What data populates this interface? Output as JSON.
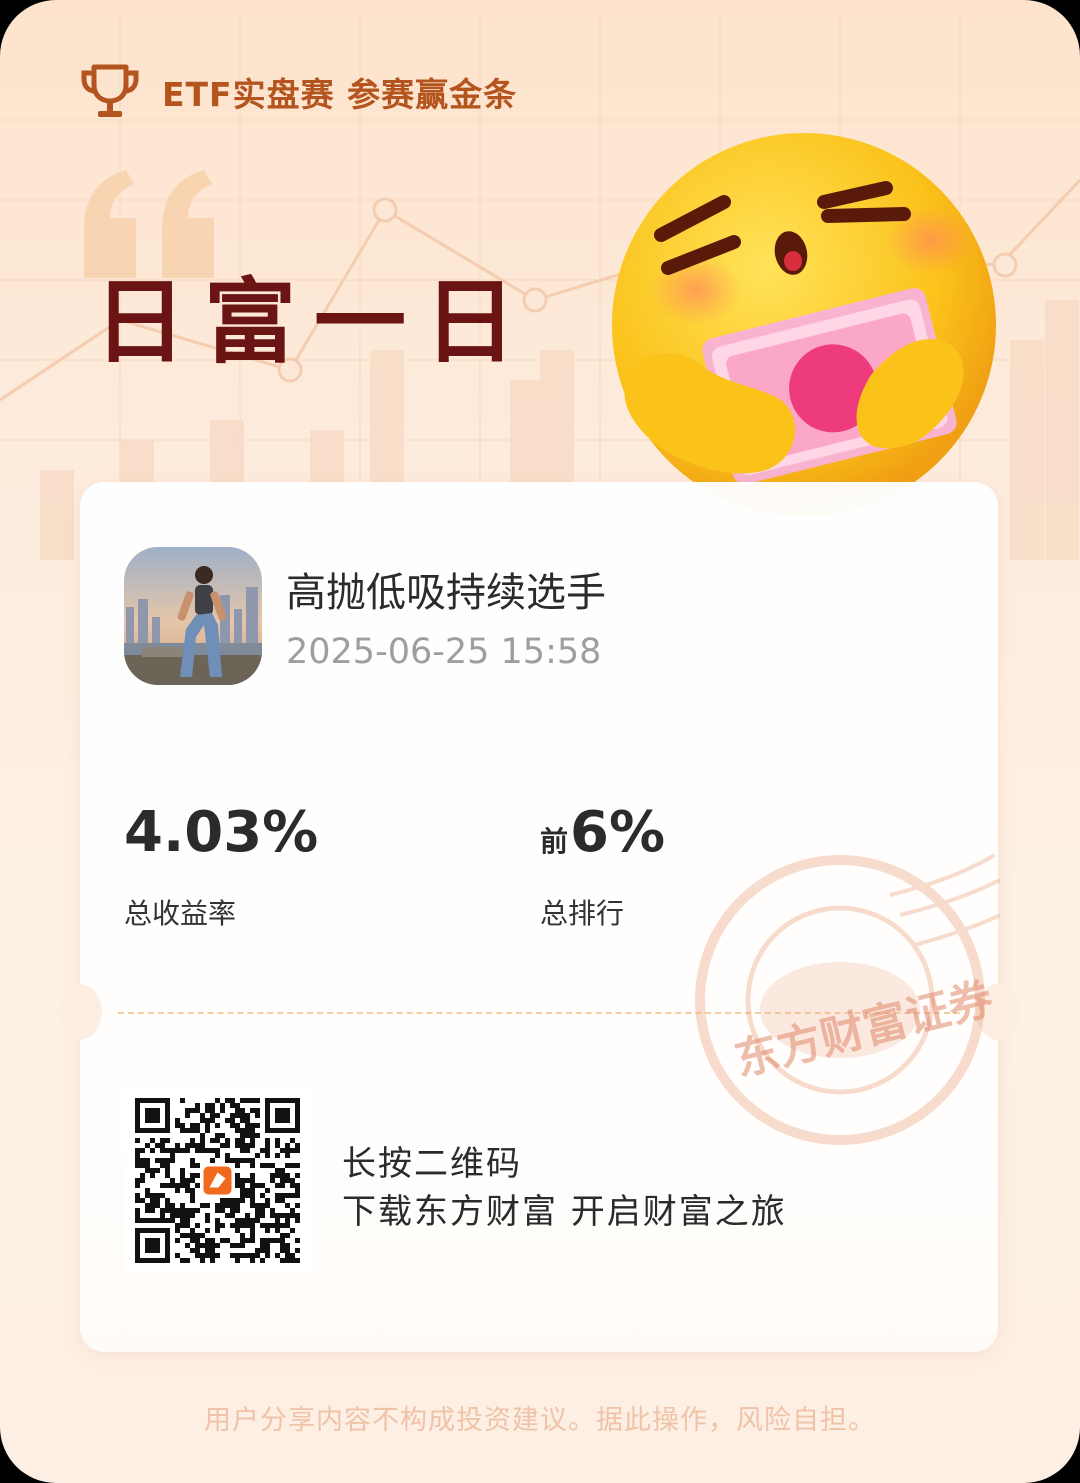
{
  "header": {
    "title": "ETF实盘赛 参赛赢金条"
  },
  "slogan": "日富一日",
  "user": {
    "name": "高抛低吸持续选手",
    "datetime": "2025-06-25 15:58"
  },
  "stats": {
    "return_value": "4.03%",
    "return_label": "总收益率",
    "rank_prefix": "前",
    "rank_value": "6%",
    "rank_label": "总排行"
  },
  "stamp_text": "东方财富证券",
  "cta": {
    "line1": "长按二维码",
    "line2": "下载东方财富 开启财富之旅"
  },
  "disclaimer": "用户分享内容不构成投资建议。据此操作，风险自担。",
  "colors": {
    "accent": "#b4541e",
    "slogan": "#6a1414",
    "disclaimer": "#efc3a8"
  }
}
